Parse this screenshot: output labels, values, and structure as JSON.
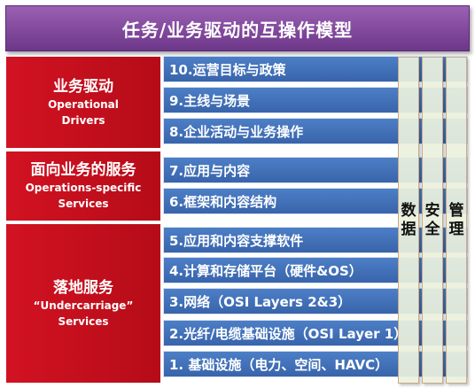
{
  "title": "任务/业务驱动的互操作模型",
  "drivers": [
    {
      "zh": "业务驱动",
      "en1": "Operational",
      "en2": "Drivers"
    },
    {
      "zh": "面向业务的服务",
      "en1": "Operations-specific",
      "en2": "Services"
    },
    {
      "zh": "落地服务",
      "en1": "“Undercarriage”",
      "en2": "Services"
    }
  ],
  "layers": [
    "10.运营目标与政策",
    "9.主线与场景",
    "8.企业活动与业务操作",
    "7.应用与内容",
    "6.框架和内容结构",
    "5.应用和内容支撑软件",
    "4.计算和存储平台（硬件&OS）",
    "3.网络（OSI Layers 2&3）",
    "2.光纤/电缆基础设施（OSI Layer 1）",
    "1. 基础设施（电力、空间、HAVC）"
  ],
  "columns": [
    {
      "c1": "数",
      "c2": "据"
    },
    {
      "c1": "安",
      "c2": "全"
    },
    {
      "c1": "管",
      "c2": "理"
    }
  ],
  "colors": {
    "title_bg": "#7e479c",
    "driver_bg": "#c8101e",
    "layer_bg": "#4371b8",
    "column_bg": "#ebf1dd"
  }
}
